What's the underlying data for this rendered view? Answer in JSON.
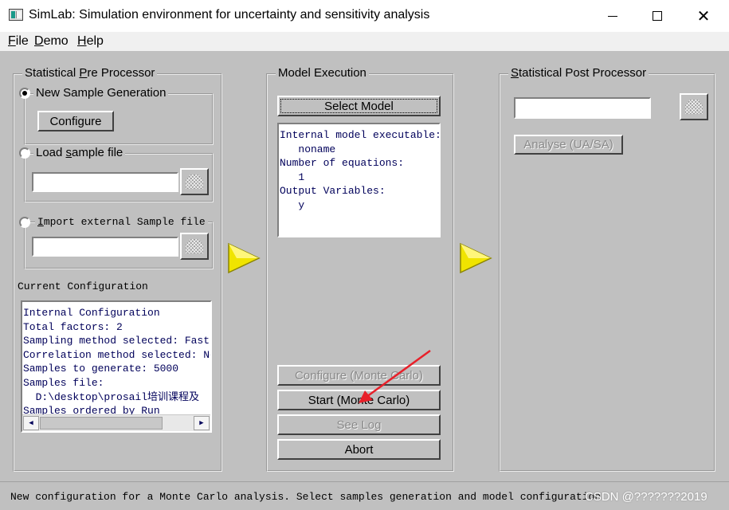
{
  "window": {
    "title": "SimLab: Simulation environment for uncertainty and sensitivity analysis",
    "minimize_glyph": "—",
    "maximize_glyph": "☐",
    "close_glyph": "✕"
  },
  "menu": {
    "file": {
      "underlined": "F",
      "rest": "ile"
    },
    "demo": {
      "underlined": "D",
      "rest": "emo"
    },
    "help": {
      "underlined": "H",
      "rest": "elp"
    }
  },
  "pre_processor": {
    "title": {
      "before": "Statistical ",
      "underlined": "P",
      "after": "re Processor"
    },
    "new_sample": {
      "label": "New Sample Generation",
      "selected": true
    },
    "configure_button": "Configure",
    "load_sample": {
      "label": {
        "before": "Load ",
        "underlined": "s",
        "after": "ample file"
      },
      "selected": false,
      "value": ""
    },
    "import_sample": {
      "label": {
        "before": "",
        "underlined": "I",
        "after": "mport external Sample file"
      },
      "selected": false,
      "value": ""
    },
    "current_configuration_label": "Current Configuration",
    "current_configuration_lines": [
      "Internal Configuration",
      "Total factors: 2",
      "Sampling method selected: Fast",
      "Correlation method selected: No",
      "Samples to generate: 5000",
      "Samples file:",
      "  D:\\desktop\\prosail培训课程及",
      "Samples ordered by Run"
    ]
  },
  "model_execution": {
    "title": "Model Execution",
    "select_model_button": "Select Model",
    "info_lines": [
      "Internal model executable:",
      "   noname",
      "Number of equations:",
      "   1",
      "Output Variables:",
      "   y"
    ],
    "configure_mc_button": "Configure (Monte Carlo)",
    "start_mc_button": "Start (Monte Carlo)",
    "see_log_button": "See Log",
    "abort_button": "Abort"
  },
  "post_processor": {
    "title": {
      "before": "",
      "underlined": "S",
      "after": "tatistical Post Processor"
    },
    "value": "",
    "analyse_button": "Analyse (UA/SA)"
  },
  "icons": {
    "flow_arrow": "yellow-play-icon",
    "browse": "folder-browse-icon",
    "annotation": "red-pointer-arrow"
  },
  "colors": {
    "panel_bg": "#c0c0c0",
    "text_box_fg": "#00005a",
    "flow_arrow": "#f0e400",
    "annotation_arrow": "#e8202a",
    "disabled_text": "#8a8a8a"
  },
  "status": {
    "message": "New configuration for a Monte Carlo analysis. Select samples generation and model configuration",
    "watermark": "CSDN @???????2019"
  }
}
